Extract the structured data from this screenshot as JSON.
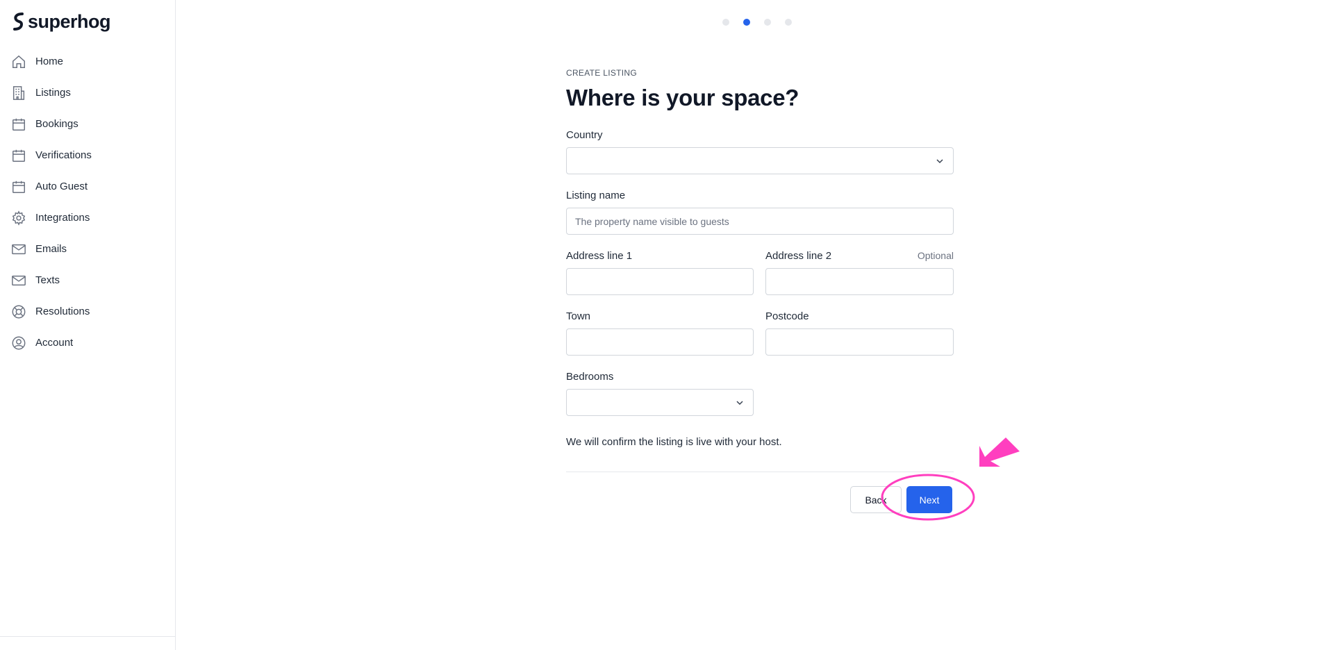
{
  "brand": {
    "name": "superhog"
  },
  "sidebar": {
    "items": [
      {
        "label": "Home",
        "icon": "home-icon"
      },
      {
        "label": "Listings",
        "icon": "building-icon"
      },
      {
        "label": "Bookings",
        "icon": "calendar-icon"
      },
      {
        "label": "Verifications",
        "icon": "calendar-icon"
      },
      {
        "label": "Auto Guest",
        "icon": "calendar-icon"
      },
      {
        "label": "Integrations",
        "icon": "gear-icon"
      },
      {
        "label": "Emails",
        "icon": "mail-icon"
      },
      {
        "label": "Texts",
        "icon": "mail-icon"
      },
      {
        "label": "Resolutions",
        "icon": "lifebuoy-icon"
      },
      {
        "label": "Account",
        "icon": "user-circle-icon"
      }
    ]
  },
  "progress": {
    "total_steps": 4,
    "current_step": 2
  },
  "form": {
    "eyebrow": "CREATE LISTING",
    "title": "Where is your space?",
    "country": {
      "label": "Country",
      "value": ""
    },
    "listing_name": {
      "label": "Listing name",
      "placeholder": "The property name visible to guests",
      "value": ""
    },
    "address1": {
      "label": "Address line 1",
      "value": ""
    },
    "address2": {
      "label": "Address line 2",
      "optional": "Optional",
      "value": ""
    },
    "town": {
      "label": "Town",
      "value": ""
    },
    "postcode": {
      "label": "Postcode",
      "value": ""
    },
    "bedrooms": {
      "label": "Bedrooms",
      "value": ""
    },
    "note": "We will confirm the listing is live with your host.",
    "back_label": "Back",
    "next_label": "Next"
  },
  "colors": {
    "accent": "#2563eb",
    "annotation": "#ff3fbf"
  }
}
